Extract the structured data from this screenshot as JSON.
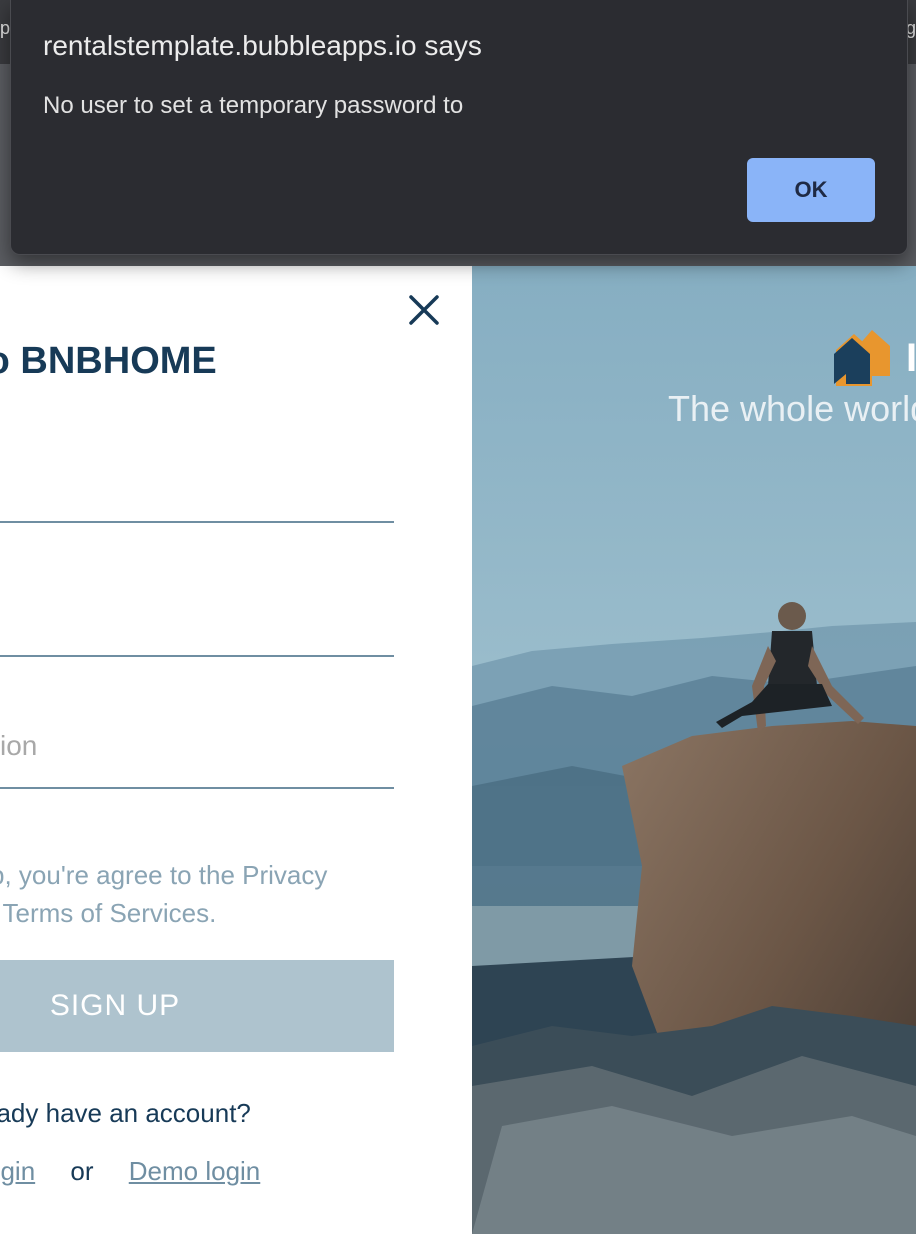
{
  "browser": {
    "left_edge_text": "p",
    "right_edge_text": "g"
  },
  "dialog": {
    "title": "rentalstemplate.bubbleapps.io says",
    "message": "No user to set a temporary password to",
    "ok_label": "OK"
  },
  "signup": {
    "title": "to BNBHOME",
    "field3_placeholder": "ion",
    "terms_line1": "p, you're agree to the Privacy",
    "terms_line2": "l Terms of Services.",
    "signup_label": "SIGN UP",
    "account_question": "eady have an account?",
    "login_label": "ogin",
    "or_label": "or",
    "demo_login_label": "Demo login"
  },
  "hero": {
    "logo_letter": "I",
    "tagline": "The whole world"
  },
  "colors": {
    "brand_dark": "#173a57",
    "brand_accent": "#e8962e",
    "button_bg": "#aec3ce",
    "dialog_bg": "#2b2c31",
    "ok_bg": "#8ab4f8"
  },
  "icons": {
    "close": "close-icon",
    "logo": "house-logo-icon"
  }
}
